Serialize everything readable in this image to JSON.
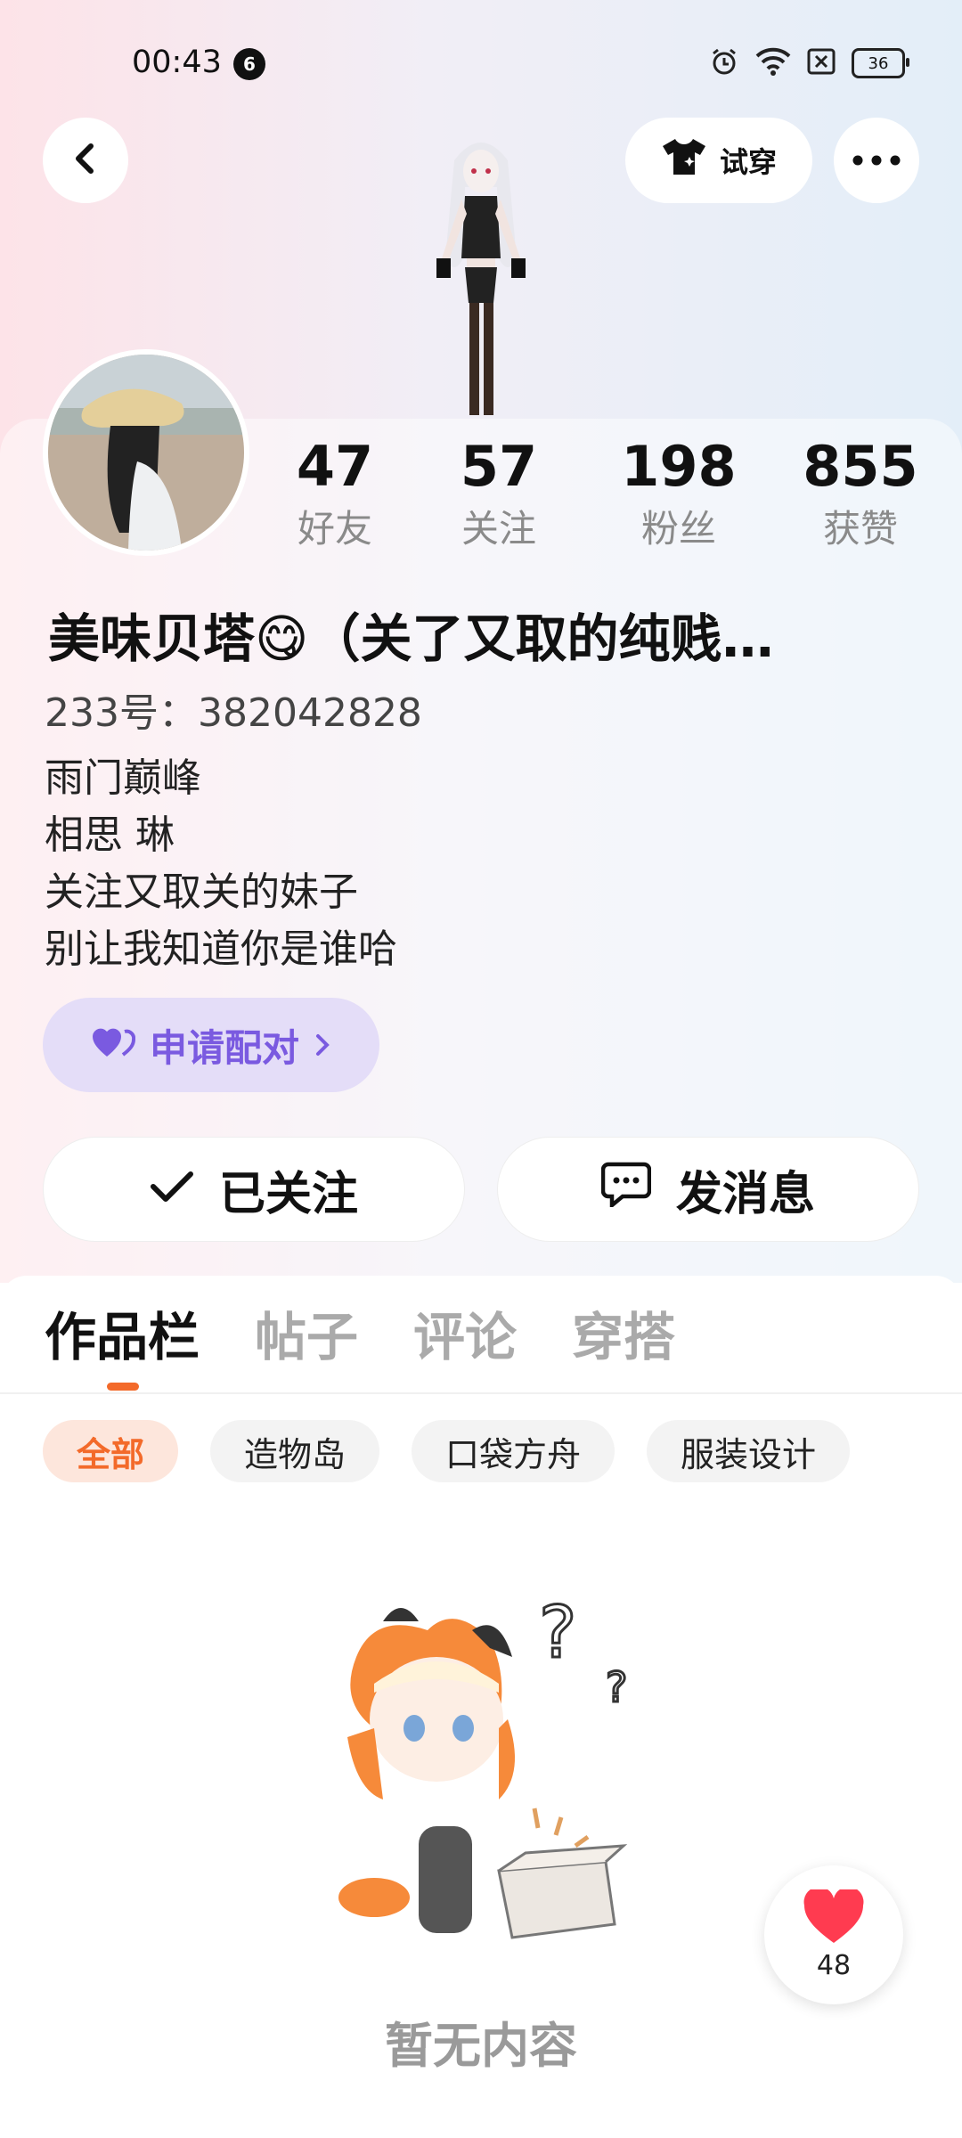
{
  "status_bar": {
    "time": "00:43",
    "notif_count": "6",
    "battery": "36"
  },
  "header": {
    "try_on_label": "试穿"
  },
  "stats": [
    {
      "value": "47",
      "label": "好友"
    },
    {
      "value": "57",
      "label": "关注"
    },
    {
      "value": "198",
      "label": "粉丝"
    },
    {
      "value": "855",
      "label": "获赞"
    }
  ],
  "profile": {
    "name": "美味贝塔😋（关了又取的纯贱…",
    "uid": "233号：382042828",
    "bio": [
      "雨门巅峰",
      "相思 琳",
      "关注又取关的妹子",
      "别让我知道你是谁哈"
    ],
    "pair_label": "申请配对",
    "follow_label": "已关注",
    "message_label": "发消息"
  },
  "tabs": [
    "作品栏",
    "帖子",
    "评论",
    "穿搭"
  ],
  "filters": [
    "全部",
    "造物岛",
    "口袋方舟",
    "服装设计"
  ],
  "empty_text": "暂无内容",
  "like_count": "48",
  "colors": {
    "accent": "#f36a2a",
    "pair": "#7a5ae0",
    "like": "#ff3b50"
  }
}
